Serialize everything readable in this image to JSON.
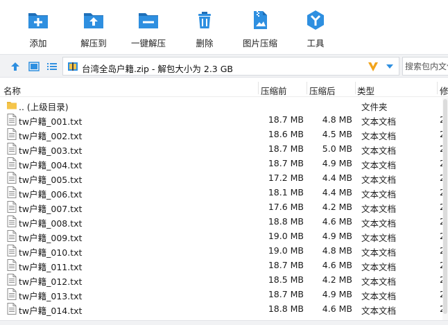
{
  "colors": {
    "accent": "#2e8fe0",
    "accent_dark": "#1f6fb8",
    "folder": "#f5c54a",
    "logo_orange": "#f2a41b"
  },
  "toolbar": {
    "add": {
      "label": "添加",
      "icon": "add-folder-icon"
    },
    "extract_to": {
      "label": "解压到",
      "icon": "extract-to-icon"
    },
    "one_click_extract": {
      "label": "一键解压",
      "icon": "one-click-extract-icon"
    },
    "delete": {
      "label": "删除",
      "icon": "trash-icon"
    },
    "image_compress": {
      "label": "图片压缩",
      "icon": "image-compress-icon"
    },
    "tools": {
      "label": "工具",
      "icon": "tools-icon"
    }
  },
  "address": {
    "path": "台湾全岛户籍.zip - 解包大小为 2.3 GB",
    "search_placeholder": "搜索包内文件"
  },
  "columns": {
    "name": "名称",
    "before": "压缩前",
    "after": "压缩后",
    "type": "类型",
    "modified": "修"
  },
  "parent": {
    "name": ".. (上级目录)",
    "type": "文件夹"
  },
  "files": [
    {
      "name": "tw户籍_001.txt",
      "before": "18.7 MB",
      "after": "4.8 MB",
      "type": "文本文档",
      "modified": "2"
    },
    {
      "name": "tw户籍_002.txt",
      "before": "18.6 MB",
      "after": "4.5 MB",
      "type": "文本文档",
      "modified": "2"
    },
    {
      "name": "tw户籍_003.txt",
      "before": "18.7 MB",
      "after": "5.0 MB",
      "type": "文本文档",
      "modified": "2"
    },
    {
      "name": "tw户籍_004.txt",
      "before": "18.7 MB",
      "after": "4.9 MB",
      "type": "文本文档",
      "modified": "2"
    },
    {
      "name": "tw户籍_005.txt",
      "before": "17.2 MB",
      "after": "4.4 MB",
      "type": "文本文档",
      "modified": "2"
    },
    {
      "name": "tw户籍_006.txt",
      "before": "18.1 MB",
      "after": "4.4 MB",
      "type": "文本文档",
      "modified": "2"
    },
    {
      "name": "tw户籍_007.txt",
      "before": "17.6 MB",
      "after": "4.2 MB",
      "type": "文本文档",
      "modified": "2"
    },
    {
      "name": "tw户籍_008.txt",
      "before": "18.8 MB",
      "after": "4.6 MB",
      "type": "文本文档",
      "modified": "2"
    },
    {
      "name": "tw户籍_009.txt",
      "before": "19.0 MB",
      "after": "4.9 MB",
      "type": "文本文档",
      "modified": "2"
    },
    {
      "name": "tw户籍_010.txt",
      "before": "19.0 MB",
      "after": "4.8 MB",
      "type": "文本文档",
      "modified": "2"
    },
    {
      "name": "tw户籍_011.txt",
      "before": "18.7 MB",
      "after": "4.6 MB",
      "type": "文本文档",
      "modified": "2"
    },
    {
      "name": "tw户籍_012.txt",
      "before": "18.5 MB",
      "after": "4.2 MB",
      "type": "文本文档",
      "modified": "2"
    },
    {
      "name": "tw户籍_013.txt",
      "before": "18.7 MB",
      "after": "4.9 MB",
      "type": "文本文档",
      "modified": "2"
    },
    {
      "name": "tw户籍_014.txt",
      "before": "18.8 MB",
      "after": "4.6 MB",
      "type": "文本文档",
      "modified": "2"
    }
  ]
}
